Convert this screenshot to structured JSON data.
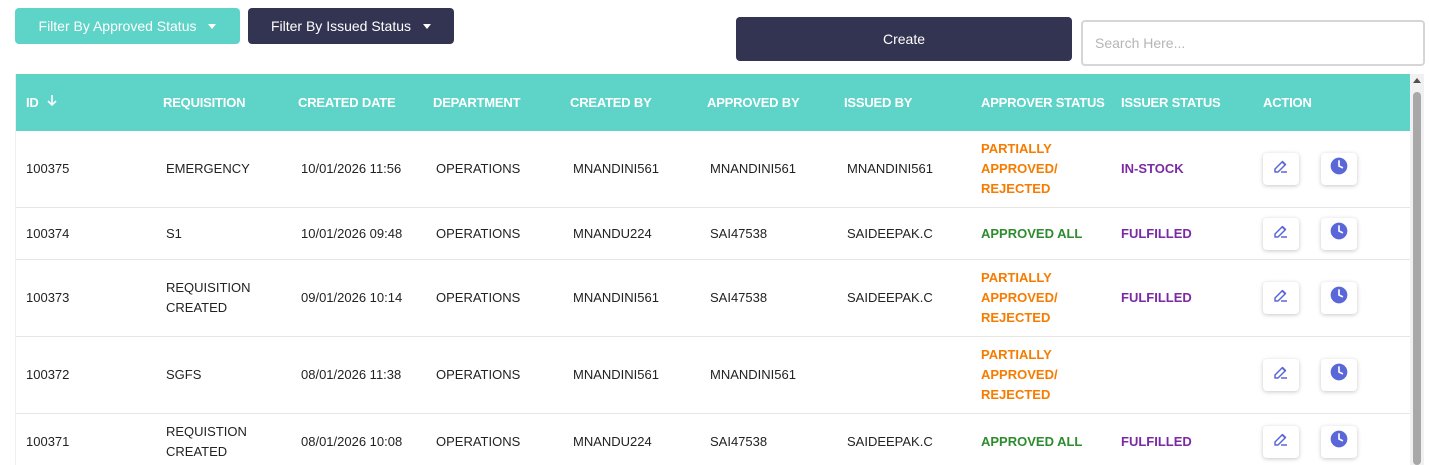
{
  "toolbar": {
    "filter_approved_label": "Filter By Approved Status",
    "filter_issued_label": "Filter By Issued Status",
    "create_label": "Create",
    "search_placeholder": "Search Here..."
  },
  "table": {
    "headers": {
      "id": "ID",
      "requisition": "REQUISITION",
      "created_date": "CREATED DATE",
      "department": "DEPARTMENT",
      "created_by": "CREATED BY",
      "approved_by": "APPROVED BY",
      "issued_by": "ISSUED BY",
      "approver_status": "APPROVER STATUS",
      "issuer_status": "ISSUER STATUS",
      "action": "ACTION"
    },
    "rows": [
      {
        "id": "100375",
        "requisition": [
          "EMERGENCY"
        ],
        "created_date": "10/01/2026 11:56",
        "department": "OPERATIONS",
        "created_by": "MNANDINI561",
        "approved_by": "MNANDINI561",
        "issued_by": "MNANDINI561",
        "approver_status": [
          "PARTIALLY",
          "APPROVED/",
          "REJECTED"
        ],
        "issuer_status": "IN-STOCK"
      },
      {
        "id": "100374",
        "requisition": [
          "S1"
        ],
        "created_date": "10/01/2026 09:48",
        "department": "OPERATIONS",
        "created_by": "MNANDU224",
        "approved_by": "SAI47538",
        "issued_by": "SAIDEEPAK.C",
        "approver_status": [
          "APPROVED ALL"
        ],
        "issuer_status": "FULFILLED"
      },
      {
        "id": "100373",
        "requisition": [
          "REQUISITION",
          "CREATED"
        ],
        "created_date": "09/01/2026 10:14",
        "department": "OPERATIONS",
        "created_by": "MNANDINI561",
        "approved_by": "SAI47538",
        "issued_by": "SAIDEEPAK.C",
        "approver_status": [
          "PARTIALLY",
          "APPROVED/",
          "REJECTED"
        ],
        "issuer_status": "FULFILLED"
      },
      {
        "id": "100372",
        "requisition": [
          "SGFS"
        ],
        "created_date": "08/01/2026 11:38",
        "department": "OPERATIONS",
        "created_by": "MNANDINI561",
        "approved_by": "MNANDINI561",
        "issued_by": "",
        "approver_status": [
          "PARTIALLY",
          "APPROVED/",
          "REJECTED"
        ],
        "issuer_status": ""
      },
      {
        "id": "100371",
        "requisition": [
          "REQUISTION",
          "CREATED"
        ],
        "created_date": "08/01/2026 10:08",
        "department": "OPERATIONS",
        "created_by": "MNANDU224",
        "approved_by": "SAI47538",
        "issued_by": "SAIDEEPAK.C",
        "approver_status": [
          "APPROVED ALL"
        ],
        "issuer_status": "FULFILLED"
      }
    ]
  },
  "colors": {
    "teal": "#5ed3c8",
    "navy": "#333352",
    "status_orange": "#f57c00",
    "status_green": "#2e8b2e",
    "status_purple": "#7b2aa5",
    "action_icon": "#5a67d8"
  },
  "icons": {
    "sort": "arrow-down-icon",
    "edit": "edit-icon",
    "history": "clock-icon"
  }
}
